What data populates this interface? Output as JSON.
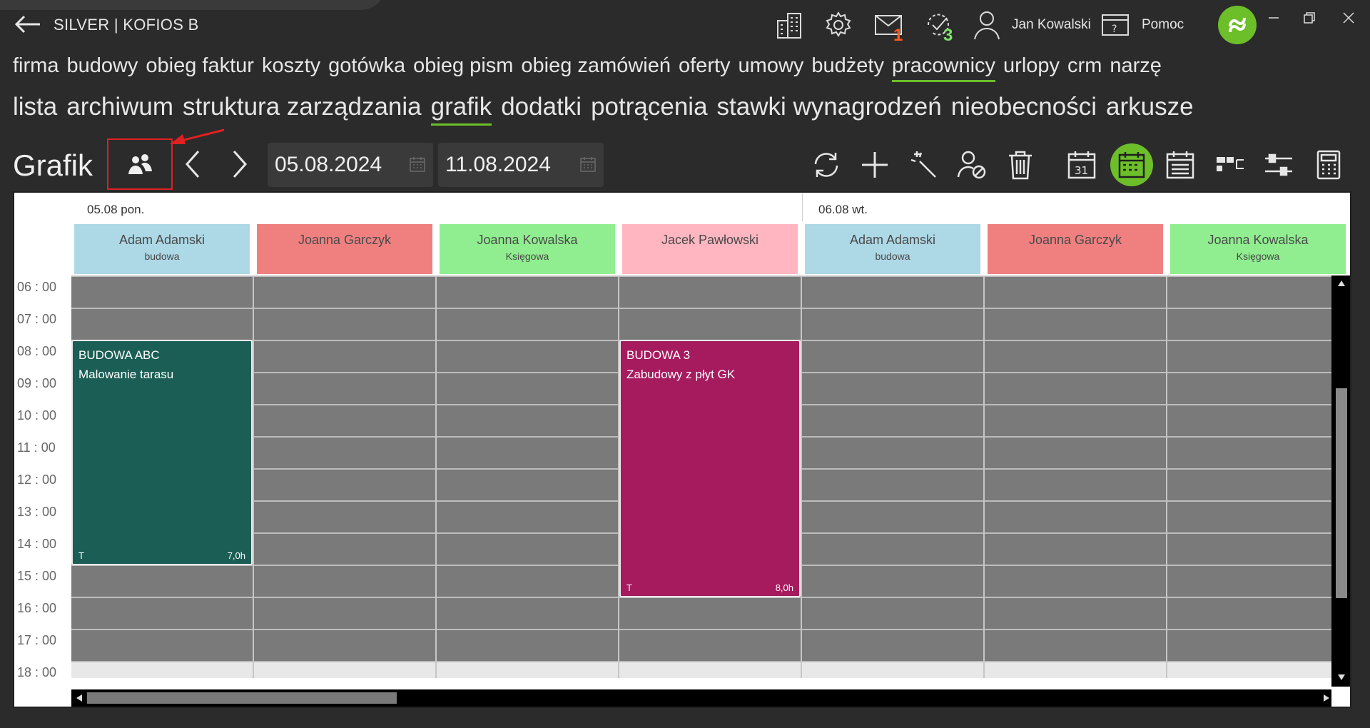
{
  "header": {
    "title": "SILVER | KOFIOS B",
    "mail_badge": "1",
    "tasks_badge": "3",
    "user_name": "Jan Kowalski",
    "help_label": "Pomoc"
  },
  "nav_primary": [
    {
      "label": "firma"
    },
    {
      "label": "budowy"
    },
    {
      "label": "obieg faktur"
    },
    {
      "label": "koszty"
    },
    {
      "label": "gotówka"
    },
    {
      "label": "obieg pism"
    },
    {
      "label": "obieg zamówień"
    },
    {
      "label": "oferty"
    },
    {
      "label": "umowy"
    },
    {
      "label": "budżety"
    },
    {
      "label": "pracownicy"
    },
    {
      "label": "urlopy"
    },
    {
      "label": "crm"
    },
    {
      "label": "narzę"
    }
  ],
  "nav_secondary": [
    {
      "label": "lista"
    },
    {
      "label": "archiwum"
    },
    {
      "label": "struktura zarządzania"
    },
    {
      "label": "grafik"
    },
    {
      "label": "dodatki"
    },
    {
      "label": "potrącenia"
    },
    {
      "label": "stawki wynagrodzeń"
    },
    {
      "label": "nieobecności"
    },
    {
      "label": "arkusze"
    }
  ],
  "toolbar": {
    "page_title": "Grafik",
    "date_from": "05.08.2024",
    "date_to": "11.08.2024"
  },
  "calendar": {
    "days": [
      {
        "label": "05.08 pon."
      },
      {
        "label": "06.08 wt."
      }
    ],
    "employees": [
      {
        "name": "Adam Adamski",
        "role": "budowa",
        "color": "#add8e6"
      },
      {
        "name": "Joanna  Garczyk",
        "role": "",
        "color": "#f08080"
      },
      {
        "name": "Joanna  Kowalska",
        "role": "Księgowa",
        "color": "#90ee90"
      },
      {
        "name": "Jacek  Pawłowski",
        "role": "",
        "color": "#ffb6c1"
      },
      {
        "name": "Adam Adamski",
        "role": "budowa",
        "color": "#add8e6"
      },
      {
        "name": "Joanna  Garczyk",
        "role": "",
        "color": "#f08080"
      },
      {
        "name": "Joanna  Kowalska",
        "role": "Księgowa",
        "color": "#90ee90"
      }
    ],
    "hours": [
      "06 : 00",
      "07 : 00",
      "08 : 00",
      "09 : 00",
      "10 : 00",
      "11 : 00",
      "12 : 00",
      "13 : 00",
      "14 : 00",
      "15 : 00",
      "16 : 00",
      "17 : 00",
      "18 : 00"
    ],
    "events": [
      {
        "title": "BUDOWA ABC",
        "subtitle": "Malowanie tarasu",
        "flag": "T",
        "duration": "7,0h",
        "color": "#1b5e55"
      },
      {
        "title": "BUDOWA 3",
        "subtitle": "Zabudowy z płyt GK",
        "flag": "T",
        "duration": "8,0h",
        "color": "#a61a5e"
      }
    ]
  },
  "colors": {
    "accent": "#6dbf2a",
    "mail_badge": "#ff5a1f",
    "tasks_badge": "#7ee36a",
    "annotation": "#e02020"
  }
}
